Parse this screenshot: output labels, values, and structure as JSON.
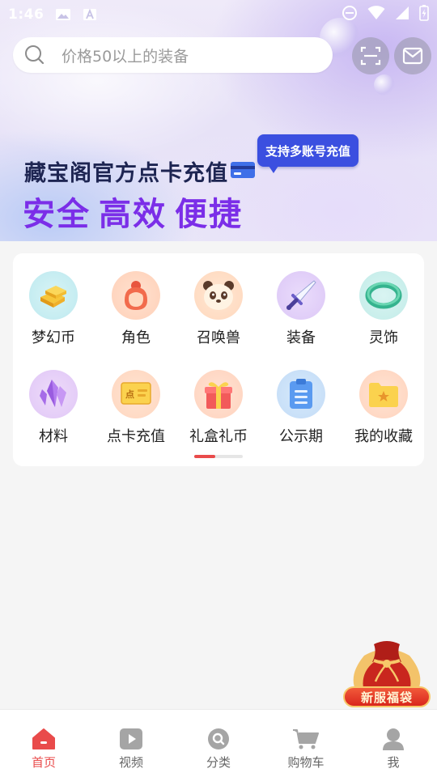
{
  "status_bar": {
    "time": "1:46",
    "icons": [
      "image-icon",
      "text-a-icon",
      "do-not-disturb-icon",
      "wifi-icon",
      "battery-icon"
    ]
  },
  "search": {
    "placeholder": "价格50以上的装备"
  },
  "header_actions": {
    "scan_icon": "scan-icon",
    "mail_icon": "mail-icon"
  },
  "banner": {
    "title": "藏宝阁官方点卡充值",
    "badge": "支持多账号充值",
    "slogan": [
      "安全",
      "高效",
      "便捷"
    ],
    "colors": {
      "title": "#1e2552",
      "slogan": "#7b2ee8",
      "badge_bg": "#3b4fe0"
    }
  },
  "categories": {
    "items": [
      {
        "label": "梦幻币",
        "icon": "gold-bars-icon"
      },
      {
        "label": "角色",
        "icon": "character-icon"
      },
      {
        "label": "召唤兽",
        "icon": "panda-icon"
      },
      {
        "label": "装备",
        "icon": "sword-icon"
      },
      {
        "label": "灵饰",
        "icon": "jade-bracelet-icon"
      },
      {
        "label": "材料",
        "icon": "crystal-icon"
      },
      {
        "label": "点卡充值",
        "icon": "point-card-icon"
      },
      {
        "label": "礼盒礼币",
        "icon": "gift-box-icon"
      },
      {
        "label": "公示期",
        "icon": "clipboard-icon"
      },
      {
        "label": "我的收藏",
        "icon": "star-folder-icon"
      }
    ]
  },
  "floating_promo": {
    "label": "新服福袋",
    "icon": "lucky-bag-icon"
  },
  "bottom_nav": {
    "active": 0,
    "items": [
      {
        "label": "首页",
        "icon": "home-icon"
      },
      {
        "label": "视频",
        "icon": "video-icon"
      },
      {
        "label": "分类",
        "icon": "category-search-icon"
      },
      {
        "label": "购物车",
        "icon": "cart-icon"
      },
      {
        "label": "我",
        "icon": "profile-icon"
      }
    ],
    "colors": {
      "active": "#e94b4b",
      "inactive": "#9e9e9e"
    }
  }
}
